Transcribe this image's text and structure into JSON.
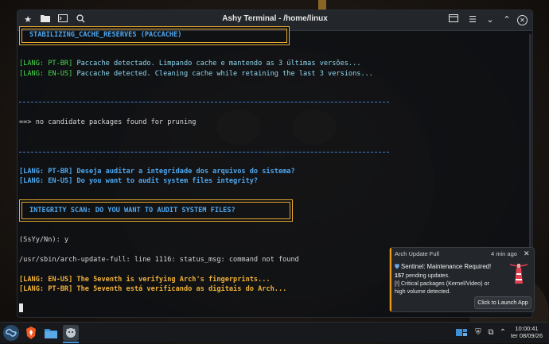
{
  "window": {
    "title": "Ashy Terminal - /home/linux"
  },
  "terminal": {
    "box1": "STABILIZING_CACHE_RESERVES (PACCACHE)",
    "lines1": [
      {
        "tag": "[LANG: PT-BR]",
        "text": " Paccache detectado. Limpando cache e mantendo as 3 últimas versões..."
      },
      {
        "tag": "[LANG: EN-US]",
        "text": " Paccache detected. Cleaning cache while retaining the last 3 versions..."
      }
    ],
    "pruning": "==> no candidate packages found for pruning",
    "audit_pt": "[LANG: PT-BR] Deseja auditar a integridade dos arquivos do sistema?",
    "audit_en": "[LANG: EN-US] Do you want to audit system files integrity?",
    "box2": "INTEGRITY SCAN: DO YOU WANT TO AUDIT SYSTEM FILES?",
    "prompt": "(SsYy/Nn): y",
    "error": "/usr/sbin/arch-update-full: line 1116: status_msg: command not found",
    "seventh_en": "[LANG: EN-US] The 5eventh is verifying Arch's fingerprints...",
    "seventh_pt": "[LANG: PT-BR] The 5eventh está verificando as digitais do Arch..."
  },
  "notification": {
    "app": "Arch Update Full",
    "age": "4 min ago",
    "title": "Sentinel: Maintenance Required!",
    "count": "157",
    "count_text": " pending updates.",
    "line3": "[!] Critical packages (Kernel/Video) or",
    "line4": "high volume detected.",
    "button": "Click to Launch App",
    "accent": "#f09a18"
  },
  "taskbar": {
    "time": "10:00:41",
    "date": "ter 08/09/26",
    "icons": [
      "system-menu-icon",
      "brave-browser-icon",
      "file-manager-icon",
      "terminal-app-icon"
    ]
  },
  "colors": {
    "green": "#49d84e",
    "blue": "#4fa8f0",
    "orange": "#f0b23a"
  }
}
